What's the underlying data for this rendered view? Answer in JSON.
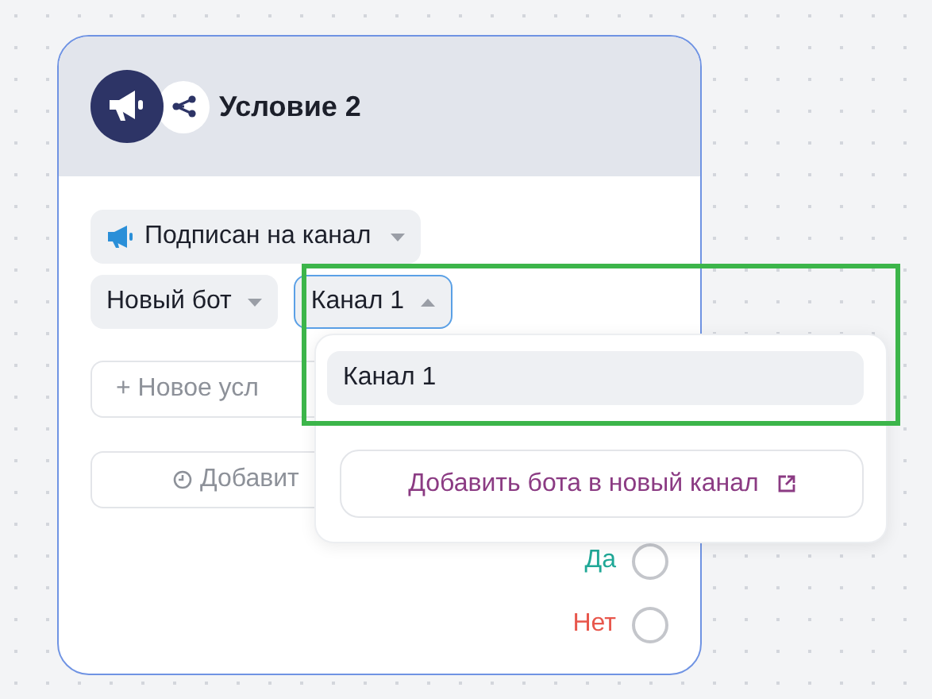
{
  "node": {
    "title": "Условие 2"
  },
  "condition": {
    "label": "Подписан на канал"
  },
  "bot_select": {
    "value": "Новый бот"
  },
  "channel_select": {
    "value": "Канал 1",
    "expanded": true
  },
  "add_condition_button": {
    "label": "+ Новое усл"
  },
  "add_delay_button": {
    "label": "Добавит"
  },
  "dropdown": {
    "options": [
      {
        "label": "Канал 1",
        "selected": true
      }
    ],
    "add_channel_button": {
      "label": "Добавить бота в новый канал"
    }
  },
  "outputs": [
    {
      "label": "Да",
      "color": "#20a897",
      "selected": false
    },
    {
      "label": "Нет",
      "color": "#e8574c",
      "selected": false
    }
  ]
}
